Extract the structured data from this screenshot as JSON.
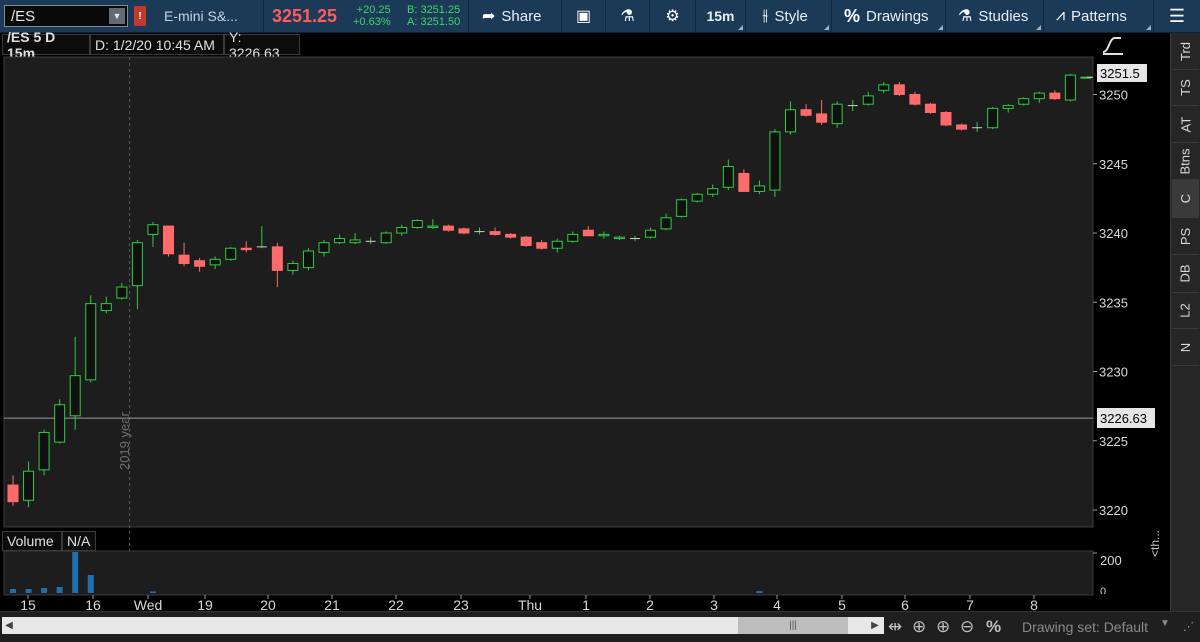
{
  "toolbar": {
    "symbol": "/ES",
    "symbol_description": "E-mini S&...",
    "last_price": "3251.25",
    "net_change": "+20.25",
    "net_change_pct": "+0.63%",
    "bid": "B: 3251.25",
    "ask": "A: 3251.50",
    "share_label": "Share",
    "timeframe_label": "15m",
    "style_label": "Style",
    "drawings_label": "Drawings",
    "studies_label": "Studies",
    "patterns_label": "Patterns"
  },
  "chart_header": {
    "description": "/ES 5 D 15m",
    "date_readout": "D: 1/2/20 10:45 AM",
    "y_readout": "Y: 3226.63"
  },
  "price_axis": {
    "last_price_tag": "3251.5",
    "cursor_price_tag": "3226.63"
  },
  "side_tabs": [
    {
      "label": "Trd",
      "active": false
    },
    {
      "label": "TS",
      "active": false
    },
    {
      "label": "AT",
      "active": false
    },
    {
      "label": "Btns",
      "active": false
    },
    {
      "label": "C",
      "active": true
    },
    {
      "label": "PS",
      "active": false
    },
    {
      "label": "DB",
      "active": false
    },
    {
      "label": "L2",
      "active": false
    },
    {
      "label": "N",
      "active": false
    }
  ],
  "side_more_label": "<th...",
  "volume_panel": {
    "label": "Volume",
    "value": "N/A",
    "y_tick_top": "200",
    "y_tick_bottom": "0"
  },
  "year_marker_label": "2019 year",
  "bottom_bar": {
    "drawing_set": "Drawing set: Default"
  },
  "colors": {
    "up": "#2ecc40",
    "down": "#ff6b6b",
    "background": "#1d1d1d",
    "toolbar": "#1b3a57",
    "volume_bar": "#1f6fb0"
  },
  "chart_data": {
    "type": "candlestick",
    "symbol": "/ES",
    "aggregation": "15m",
    "ylim": [
      3219,
      3253
    ],
    "y_ticks": [
      3220,
      3225,
      3230,
      3235,
      3240,
      3245,
      3250
    ],
    "x_tick_labels": [
      "15",
      "16",
      "Wed",
      "19",
      "20",
      "21",
      "22",
      "23",
      "Thu",
      "1",
      "2",
      "3",
      "4",
      "5",
      "6",
      "7",
      "8"
    ],
    "grid": false,
    "candles": [
      {
        "o": 3221.8,
        "h": 3222.5,
        "l": 3220.3,
        "c": 3220.6
      },
      {
        "o": 3220.7,
        "h": 3223.5,
        "l": 3220.2,
        "c": 3222.8
      },
      {
        "o": 3222.9,
        "h": 3225.8,
        "l": 3222.5,
        "c": 3225.6
      },
      {
        "o": 3224.9,
        "h": 3228.0,
        "l": 3224.8,
        "c": 3227.6
      },
      {
        "o": 3226.8,
        "h": 3232.5,
        "l": 3225.8,
        "c": 3229.7
      },
      {
        "o": 3229.4,
        "h": 3235.5,
        "l": 3229.2,
        "c": 3234.9
      },
      {
        "o": 3234.4,
        "h": 3235.4,
        "l": 3234.2,
        "c": 3234.9
      },
      {
        "o": 3235.3,
        "h": 3236.4,
        "l": 3235.2,
        "c": 3236.1
      },
      {
        "o": 3236.2,
        "h": 3239.5,
        "l": 3234.5,
        "c": 3239.3
      },
      {
        "o": 3239.9,
        "h": 3240.8,
        "l": 3239.0,
        "c": 3240.6
      },
      {
        "o": 3240.5,
        "h": 3240.5,
        "l": 3238.3,
        "c": 3238.5
      },
      {
        "o": 3238.4,
        "h": 3239.3,
        "l": 3237.6,
        "c": 3237.8
      },
      {
        "o": 3238.0,
        "h": 3238.2,
        "l": 3237.2,
        "c": 3237.6
      },
      {
        "o": 3237.7,
        "h": 3238.3,
        "l": 3237.4,
        "c": 3238.1
      },
      {
        "o": 3238.1,
        "h": 3239.0,
        "l": 3238.0,
        "c": 3238.9
      },
      {
        "o": 3238.9,
        "h": 3239.4,
        "l": 3238.6,
        "c": 3238.8
      },
      {
        "o": 3239.0,
        "h": 3240.5,
        "l": 3238.9,
        "c": 3239.0
      },
      {
        "o": 3239.0,
        "h": 3239.3,
        "l": 3236.1,
        "c": 3237.3
      },
      {
        "o": 3237.3,
        "h": 3238.0,
        "l": 3237.0,
        "c": 3237.8
      },
      {
        "o": 3237.5,
        "h": 3238.9,
        "l": 3237.3,
        "c": 3238.7
      },
      {
        "o": 3238.6,
        "h": 3239.5,
        "l": 3238.3,
        "c": 3239.3
      },
      {
        "o": 3239.3,
        "h": 3239.9,
        "l": 3239.2,
        "c": 3239.6
      },
      {
        "o": 3239.3,
        "h": 3240.0,
        "l": 3239.2,
        "c": 3239.5
      },
      {
        "o": 3239.4,
        "h": 3239.7,
        "l": 3239.2,
        "c": 3239.4
      },
      {
        "o": 3239.3,
        "h": 3240.1,
        "l": 3239.2,
        "c": 3240.0
      },
      {
        "o": 3240.0,
        "h": 3240.6,
        "l": 3239.8,
        "c": 3240.4
      },
      {
        "o": 3240.4,
        "h": 3241.0,
        "l": 3240.3,
        "c": 3240.9
      },
      {
        "o": 3240.4,
        "h": 3241.0,
        "l": 3240.3,
        "c": 3240.5
      },
      {
        "o": 3240.5,
        "h": 3240.6,
        "l": 3240.1,
        "c": 3240.2
      },
      {
        "o": 3240.3,
        "h": 3240.4,
        "l": 3239.9,
        "c": 3240.0
      },
      {
        "o": 3240.1,
        "h": 3240.4,
        "l": 3239.9,
        "c": 3240.1
      },
      {
        "o": 3240.1,
        "h": 3240.4,
        "l": 3239.8,
        "c": 3239.9
      },
      {
        "o": 3239.9,
        "h": 3240.0,
        "l": 3239.6,
        "c": 3239.7
      },
      {
        "o": 3239.7,
        "h": 3239.8,
        "l": 3239.0,
        "c": 3239.1
      },
      {
        "o": 3239.3,
        "h": 3239.5,
        "l": 3238.8,
        "c": 3238.9
      },
      {
        "o": 3238.9,
        "h": 3239.6,
        "l": 3238.6,
        "c": 3239.4
      },
      {
        "o": 3239.4,
        "h": 3240.1,
        "l": 3239.3,
        "c": 3239.9
      },
      {
        "o": 3240.2,
        "h": 3240.5,
        "l": 3239.8,
        "c": 3239.8
      },
      {
        "o": 3239.8,
        "h": 3240.1,
        "l": 3239.6,
        "c": 3239.9
      },
      {
        "o": 3239.6,
        "h": 3239.8,
        "l": 3239.5,
        "c": 3239.7
      },
      {
        "o": 3239.6,
        "h": 3239.8,
        "l": 3239.4,
        "c": 3239.6
      },
      {
        "o": 3239.7,
        "h": 3240.4,
        "l": 3239.6,
        "c": 3240.2
      },
      {
        "o": 3240.3,
        "h": 3241.4,
        "l": 3240.2,
        "c": 3241.1
      },
      {
        "o": 3241.2,
        "h": 3242.5,
        "l": 3241.1,
        "c": 3242.4
      },
      {
        "o": 3242.3,
        "h": 3242.9,
        "l": 3242.2,
        "c": 3242.8
      },
      {
        "o": 3242.8,
        "h": 3243.5,
        "l": 3242.6,
        "c": 3243.2
      },
      {
        "o": 3243.3,
        "h": 3245.3,
        "l": 3243.1,
        "c": 3244.8
      },
      {
        "o": 3244.3,
        "h": 3244.6,
        "l": 3243.0,
        "c": 3243.0
      },
      {
        "o": 3243.0,
        "h": 3243.8,
        "l": 3242.8,
        "c": 3243.4
      },
      {
        "o": 3243.1,
        "h": 3247.5,
        "l": 3242.6,
        "c": 3247.3
      },
      {
        "o": 3247.3,
        "h": 3249.5,
        "l": 3247.1,
        "c": 3248.9
      },
      {
        "o": 3248.9,
        "h": 3249.3,
        "l": 3248.4,
        "c": 3248.5
      },
      {
        "o": 3248.6,
        "h": 3249.6,
        "l": 3247.8,
        "c": 3248.0
      },
      {
        "o": 3247.9,
        "h": 3249.5,
        "l": 3247.6,
        "c": 3249.3
      },
      {
        "o": 3249.2,
        "h": 3249.6,
        "l": 3248.8,
        "c": 3249.2
      },
      {
        "o": 3249.3,
        "h": 3250.2,
        "l": 3249.2,
        "c": 3249.9
      },
      {
        "o": 3250.3,
        "h": 3250.9,
        "l": 3250.1,
        "c": 3250.7
      },
      {
        "o": 3250.7,
        "h": 3250.9,
        "l": 3249.9,
        "c": 3250.0
      },
      {
        "o": 3250.0,
        "h": 3250.2,
        "l": 3249.2,
        "c": 3249.3
      },
      {
        "o": 3249.3,
        "h": 3249.4,
        "l": 3248.6,
        "c": 3248.7
      },
      {
        "o": 3248.7,
        "h": 3248.8,
        "l": 3247.7,
        "c": 3247.8
      },
      {
        "o": 3247.8,
        "h": 3247.9,
        "l": 3247.4,
        "c": 3247.5
      },
      {
        "o": 3247.6,
        "h": 3248.0,
        "l": 3247.3,
        "c": 3247.6
      },
      {
        "o": 3247.6,
        "h": 3249.1,
        "l": 3247.5,
        "c": 3249.0
      },
      {
        "o": 3249.0,
        "h": 3249.3,
        "l": 3248.7,
        "c": 3249.2
      },
      {
        "o": 3249.3,
        "h": 3249.8,
        "l": 3249.2,
        "c": 3249.7
      },
      {
        "o": 3249.7,
        "h": 3250.2,
        "l": 3249.4,
        "c": 3250.1
      },
      {
        "o": 3250.1,
        "h": 3250.3,
        "l": 3249.6,
        "c": 3249.7
      },
      {
        "o": 3249.6,
        "h": 3251.5,
        "l": 3249.5,
        "c": 3251.4
      },
      {
        "o": 3251.2,
        "h": 3251.3,
        "l": 3251.2,
        "c": 3251.25
      }
    ],
    "volume_ylim": [
      0,
      200
    ],
    "volume": [
      20,
      20,
      25,
      30,
      205,
      90,
      0,
      0,
      0,
      8,
      0,
      0,
      0,
      0,
      0,
      0,
      0,
      0,
      0,
      0,
      0,
      0,
      0,
      0,
      0,
      0,
      0,
      0,
      0,
      0,
      0,
      0,
      0,
      0,
      0,
      0,
      0,
      0,
      0,
      0,
      0,
      0,
      0,
      0,
      0,
      0,
      0,
      0,
      10,
      0,
      0,
      0,
      0,
      0,
      0,
      0,
      0,
      0,
      0,
      0,
      0,
      0,
      0,
      0,
      0,
      0,
      0,
      0,
      0,
      0
    ]
  }
}
